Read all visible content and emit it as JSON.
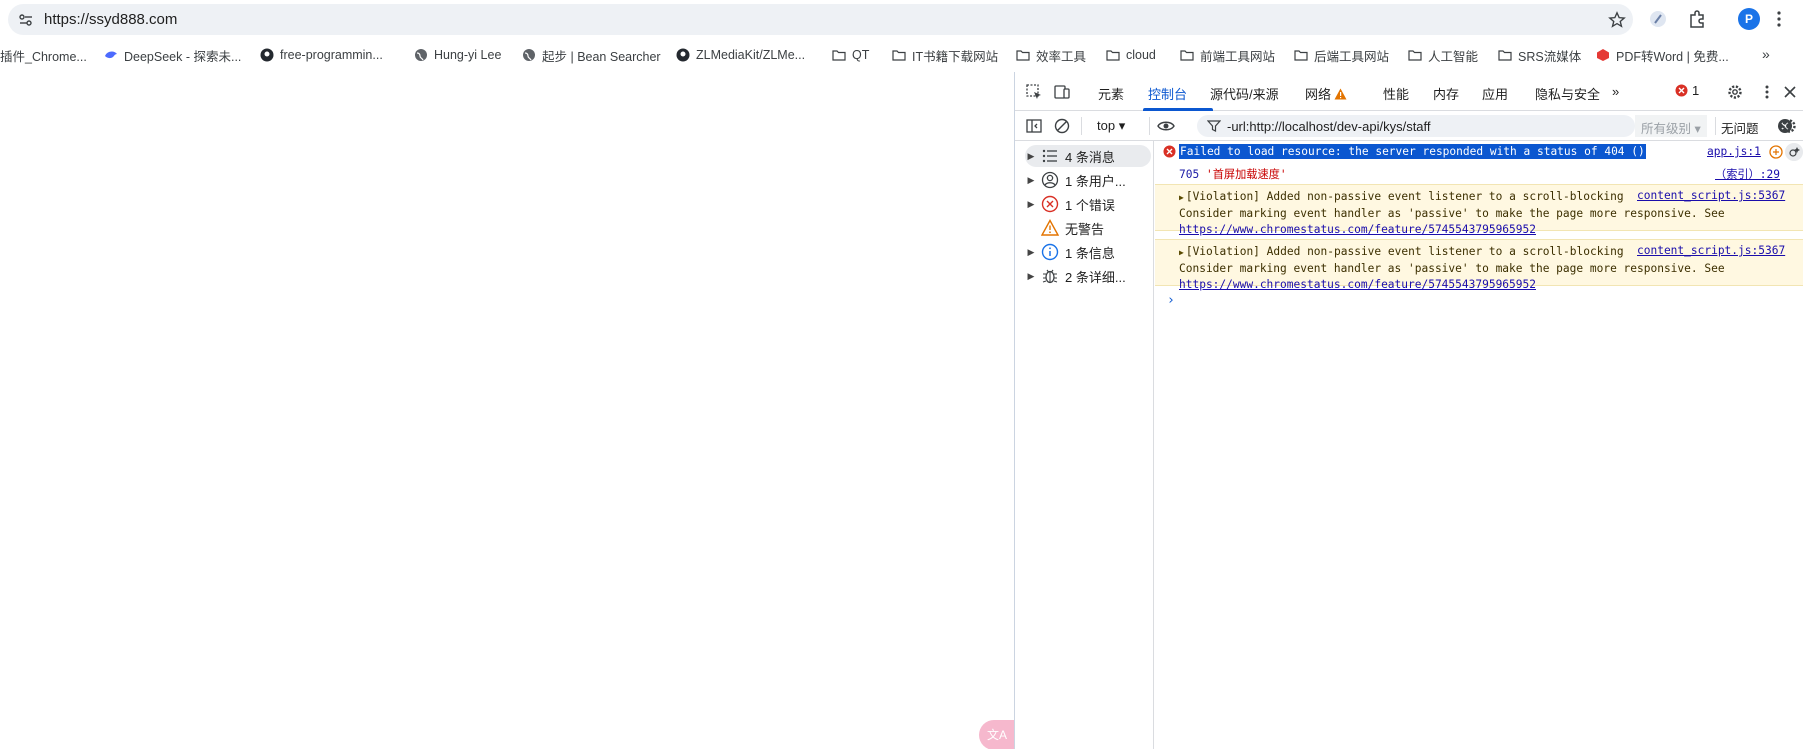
{
  "browser": {
    "url": "https://ssyd888.com",
    "profile_initial": "P"
  },
  "bookmarks": [
    {
      "label": "插件_Chrome...",
      "icon": "puzzle-icon"
    },
    {
      "label": "DeepSeek - 探索未...",
      "icon": "deepseek-whale-icon"
    },
    {
      "label": "free-programmin...",
      "icon": "github-icon"
    },
    {
      "label": "Hung-yi Lee",
      "icon": "globe-icon"
    },
    {
      "label": "起步 | Bean Searcher",
      "icon": "globe-icon"
    },
    {
      "label": "ZLMediaKit/ZLMe...",
      "icon": "github-icon"
    },
    {
      "label": "QT",
      "icon": "folder-icon"
    },
    {
      "label": "IT书籍下载网站",
      "icon": "folder-icon"
    },
    {
      "label": "效率工具",
      "icon": "folder-icon"
    },
    {
      "label": "cloud",
      "icon": "folder-icon"
    },
    {
      "label": "前端工具网站",
      "icon": "folder-icon"
    },
    {
      "label": "后端工具网站",
      "icon": "folder-icon"
    },
    {
      "label": "人工智能",
      "icon": "folder-icon"
    },
    {
      "label": "SRS流媒体",
      "icon": "folder-icon"
    },
    {
      "label": "PDF转Word | 免费...",
      "icon": "pdf-icon"
    }
  ],
  "page": {
    "translate_fab": "文A"
  },
  "devtools": {
    "tabs": [
      "元素",
      "控制台",
      "源代码/来源",
      "网络",
      "性能",
      "内存",
      "应用",
      "隐私与安全"
    ],
    "active_tab": "控制台",
    "overflow": "»",
    "error_count": "1",
    "toolbar": {
      "context": "top",
      "filter_value": "-url:http://localhost/dev-api/kys/staff",
      "levels": "所有级别",
      "issues": "无问题"
    },
    "sidebar": [
      {
        "label": "4 条消息",
        "icon": "list-icon",
        "expandable": true
      },
      {
        "label": "1 条用户...",
        "icon": "user-icon",
        "expandable": true
      },
      {
        "label": "1 个错误",
        "icon": "error-icon",
        "expandable": true
      },
      {
        "label": "无警告",
        "icon": "warning-icon",
        "expandable": false
      },
      {
        "label": "1 条信息",
        "icon": "info-icon",
        "expandable": true
      },
      {
        "label": "2 条详细...",
        "icon": "bug-icon",
        "expandable": true
      }
    ],
    "console": {
      "error": {
        "text": "Failed to load resource: the server responded with a status of 404 ()",
        "source": "app.js:1"
      },
      "log": {
        "number": "705",
        "string": "'首屏加载速度'",
        "source": "（索引）:29"
      },
      "violations": [
        {
          "text": "[Violation] Added non-passive event listener to a scroll-blocking 'touchstart' event. Consider marking event handler as 'passive' to make the page more responsive. See ",
          "link": "https://www.chromestatus.com/feature/5745543795965952",
          "source": "content_script.js:5367"
        },
        {
          "text": "[Violation] Added non-passive event listener to a scroll-blocking 'touchstart' event. Consider marking event handler as 'passive' to make the page more responsive. See ",
          "link": "https://www.chromestatus.com/feature/5745543795965952",
          "source": "content_script.js:5367"
        }
      ],
      "prompt": "›"
    }
  },
  "colors": {
    "accent": "#0b57d0",
    "error": "#d93025",
    "warning": "#e37400",
    "violation_bg": "#fff8e1"
  }
}
